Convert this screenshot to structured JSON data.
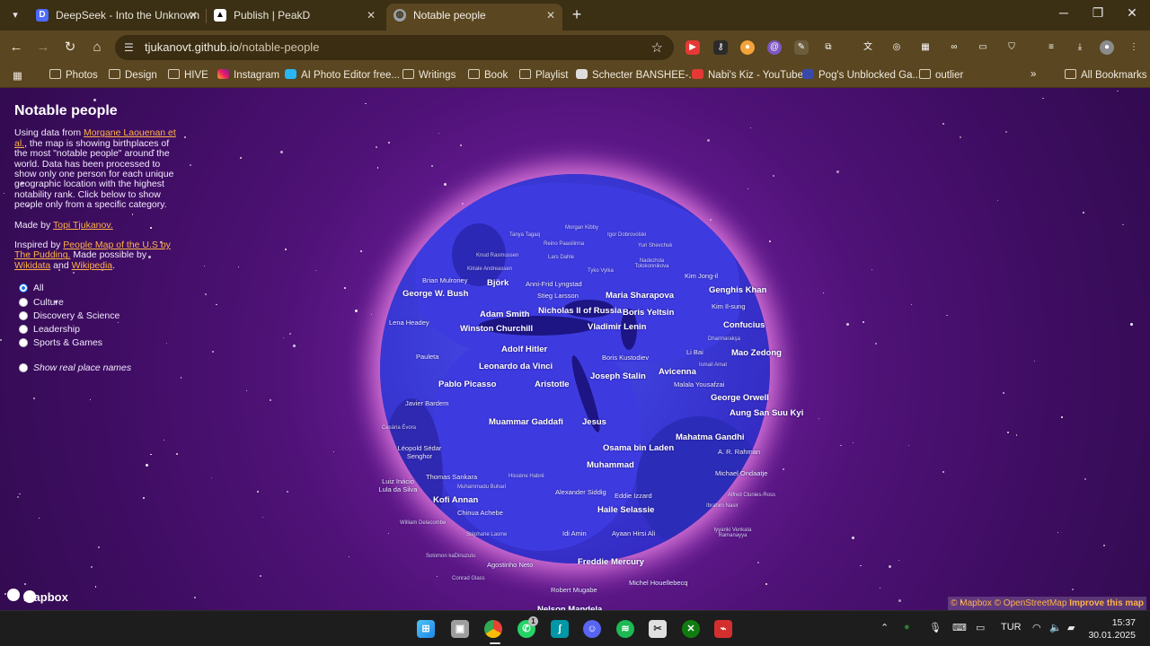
{
  "browser": {
    "tabs": [
      {
        "title": "DeepSeek - Into the Unknown",
        "icon": "deepseek-icon",
        "active": false
      },
      {
        "title": "Publish | PeakD",
        "icon": "peakd-icon",
        "active": false
      },
      {
        "title": "Notable people",
        "icon": "globe-icon",
        "active": true
      }
    ],
    "url_host": "tjukanovt.github.io",
    "url_path": "/notable-people"
  },
  "bookmarks": [
    {
      "label": "Photos",
      "icon": "folder-icon"
    },
    {
      "label": "Design",
      "icon": "folder-icon"
    },
    {
      "label": "HIVE",
      "icon": "folder-icon"
    },
    {
      "label": "Instagram",
      "icon": "instagram-icon"
    },
    {
      "label": "AI Photo Editor free...",
      "icon": "app-icon"
    },
    {
      "label": "Writings",
      "icon": "folder-icon"
    },
    {
      "label": "Book",
      "icon": "folder-icon"
    },
    {
      "label": "Playlist",
      "icon": "folder-icon"
    },
    {
      "label": "Schecter BANSHEE-...",
      "icon": "guitar-icon"
    },
    {
      "label": "Nabi's Kiz - YouTube",
      "icon": "youtube-icon"
    },
    {
      "label": "Pog's Unblocked Ga...",
      "icon": "game-icon"
    },
    {
      "label": "outlier",
      "icon": "folder-icon"
    }
  ],
  "bookmarks_overflow": "»",
  "all_bookmarks": "All Bookmarks",
  "sidebar": {
    "title": "Notable people",
    "intro_prefix": "Using data from ",
    "intro_link": "Morgane Laouenan et al.",
    "intro_rest": ", the map is showing birthplaces of the most \"notable people\" around the world. Data has been processed to show only one person for each unique geographic location with the highest notability rank. Click below to show people only from a specific category.",
    "made_by_prefix": "Made by ",
    "made_by_link": "Topi Tjukanov.",
    "inspired_prefix": "Inspired by ",
    "inspired_link": "People Map of the U.S by The Pudding.",
    "possible_text": " Made possible by ",
    "wikidata_link": "Wikidata",
    "and_text": " and ",
    "wikipedia_link": "Wikipedia",
    "period": ".",
    "categories": [
      {
        "label": "All",
        "checked": true
      },
      {
        "label": "Culture",
        "checked": false
      },
      {
        "label": "Discovery & Science",
        "checked": false
      },
      {
        "label": "Leadership",
        "checked": false
      },
      {
        "label": "Sports & Games",
        "checked": false
      }
    ],
    "real_place_names": "Show real place names"
  },
  "map_labels": {
    "big": [
      "George W. Bush",
      "Björk",
      "Maria Sharapova",
      "Genghis Khan",
      "Nicholas II of Russia",
      "Boris Yeltsin",
      "Adam Smith",
      "Winston Churchill",
      "Vladimir Lenin",
      "Confucius",
      "Adolf Hitler",
      "Mao Zedong",
      "Leonardo da Vinci",
      "Joseph Stalin",
      "Avicenna",
      "Pablo Picasso",
      "Aristotle",
      "George Orwell",
      "Aung San Suu Kyi",
      "Muammar Gaddafi",
      "Jesus",
      "Mahatma Gandhi",
      "Osama bin Laden",
      "Muhammad",
      "Kofi Annan",
      "Haile Selassie",
      "Freddie Mercury",
      "Nelson Mandela"
    ],
    "mid": [
      "Anni-Frid Lyngstad",
      "Stieg Larsson",
      "Kim Jong-il",
      "Kim Il-sung",
      "Lena Headey",
      "Pauleta",
      "Li Bai",
      "Malala Yousafzai",
      "Javier Bardem",
      "A. R. Rahman",
      "Chinua Achebe",
      "Idi Amin",
      "Ayaan Hirsi Ali",
      "Robert Mugabe",
      "Michel Houellebecq",
      "Luiz Inácio Lula da Silva",
      "Léopold Sédar Senghor",
      "Thomas Sankara",
      "Alexander Siddig",
      "Eddie Izzard",
      "Michael Ondaatje",
      "Agostinho Neto",
      "Brian Mulroney",
      "Boris Kustodiev"
    ],
    "small": [
      "Morgan Kibby",
      "Tanya Tagaq",
      "Igor Dobrovolski",
      "Reino Paasilinna",
      "Yuri Shevchuk",
      "Knud Rasmussen",
      "Lars Dahle",
      "Nadezhda Tolokonnikova",
      "Kilrale Andreassen",
      "Tyko Vylka",
      "Dharmarakşa",
      "Ismail Amat",
      "Cesária Évora",
      "Hissène Habré",
      "Muhammadu Buhari",
      "Alfred Clunies-Ross",
      "Ibrahim Nasir",
      "William Delacombe",
      "Iyyanki Venkata Ramanayya",
      "Stéphane Lasme",
      "Solomon kaDinuzulu",
      "Conrad Glass"
    ]
  },
  "attribution": {
    "mapbox": "© Mapbox",
    "osm": "© OpenStreetMap",
    "improve": "Improve this map",
    "logo": "mapbox"
  },
  "taskbar": {
    "language": "TUR",
    "time": "15:37",
    "date": "30.01.2025",
    "whatsapp_badge": "1"
  }
}
